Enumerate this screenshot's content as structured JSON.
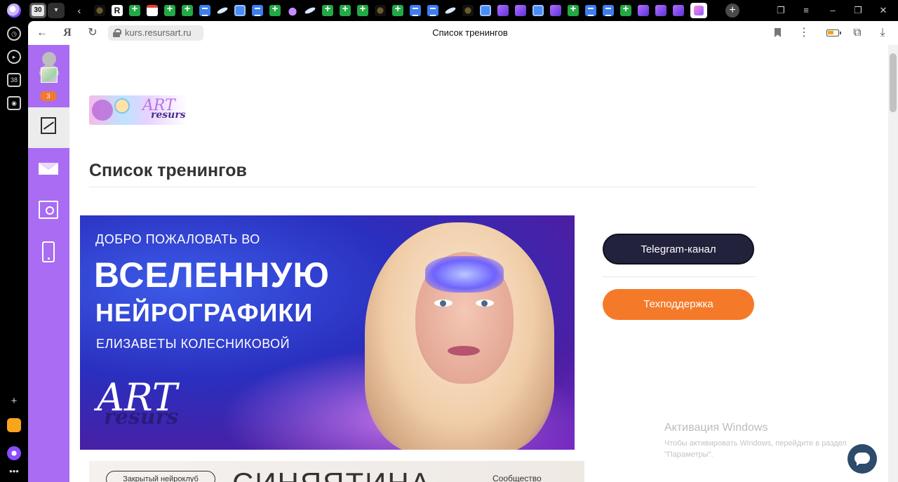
{
  "browser": {
    "tab_count": "30",
    "url": "kurs.resursart.ru",
    "page_title": "Список тренингов",
    "tabs_favicons": [
      "dark",
      "r",
      "green",
      "gmail",
      "green",
      "green",
      "blue",
      "feather",
      "blueg",
      "blue",
      "green",
      "drop",
      "feather",
      "green",
      "green",
      "green",
      "dark",
      "green",
      "blue",
      "blue",
      "feather",
      "dark",
      "blueg",
      "purple",
      "purple",
      "blueg",
      "purple",
      "green",
      "blue",
      "blue",
      "green",
      "purple",
      "purple",
      "purple",
      "active"
    ],
    "sidebar_badge": "38"
  },
  "site_nav": {
    "notification_count": "3",
    "items": [
      {
        "name": "trainings",
        "active": true
      },
      {
        "name": "messages",
        "active": false
      },
      {
        "name": "safe",
        "active": false
      },
      {
        "name": "mobile",
        "active": false
      }
    ]
  },
  "logo": {
    "art": "ART",
    "resurs": "resurs"
  },
  "main": {
    "heading": "Список тренингов",
    "banner": {
      "line1": "ДОБРО ПОЖАЛОВАТЬ ВО",
      "line2": "ВСЕЛЕННУЮ",
      "line3": "НЕЙРОГРАФИКИ",
      "line4": "ЕЛИЗАВЕТЫ КОЛЕСНИКОВОЙ",
      "logo_art": "ART",
      "logo_resurs": "resurs"
    },
    "banner2": {
      "tag": "Закрытый нейроклуб",
      "big_text": "СИНЯЯТИНА",
      "small": "Сообщество"
    },
    "buttons": {
      "telegram": "Telegram-канал",
      "support": "Техподдержка"
    }
  },
  "windows_activation": {
    "title": "Активация Windows",
    "subtitle": "Чтобы активировать Windows, перейдите в раздел \"Параметры\"."
  },
  "colors": {
    "site_nav": "#a96cf3",
    "telegram_button": "#23223d",
    "support_button": "#f47a2a",
    "chat_button": "#2e4b6b"
  }
}
